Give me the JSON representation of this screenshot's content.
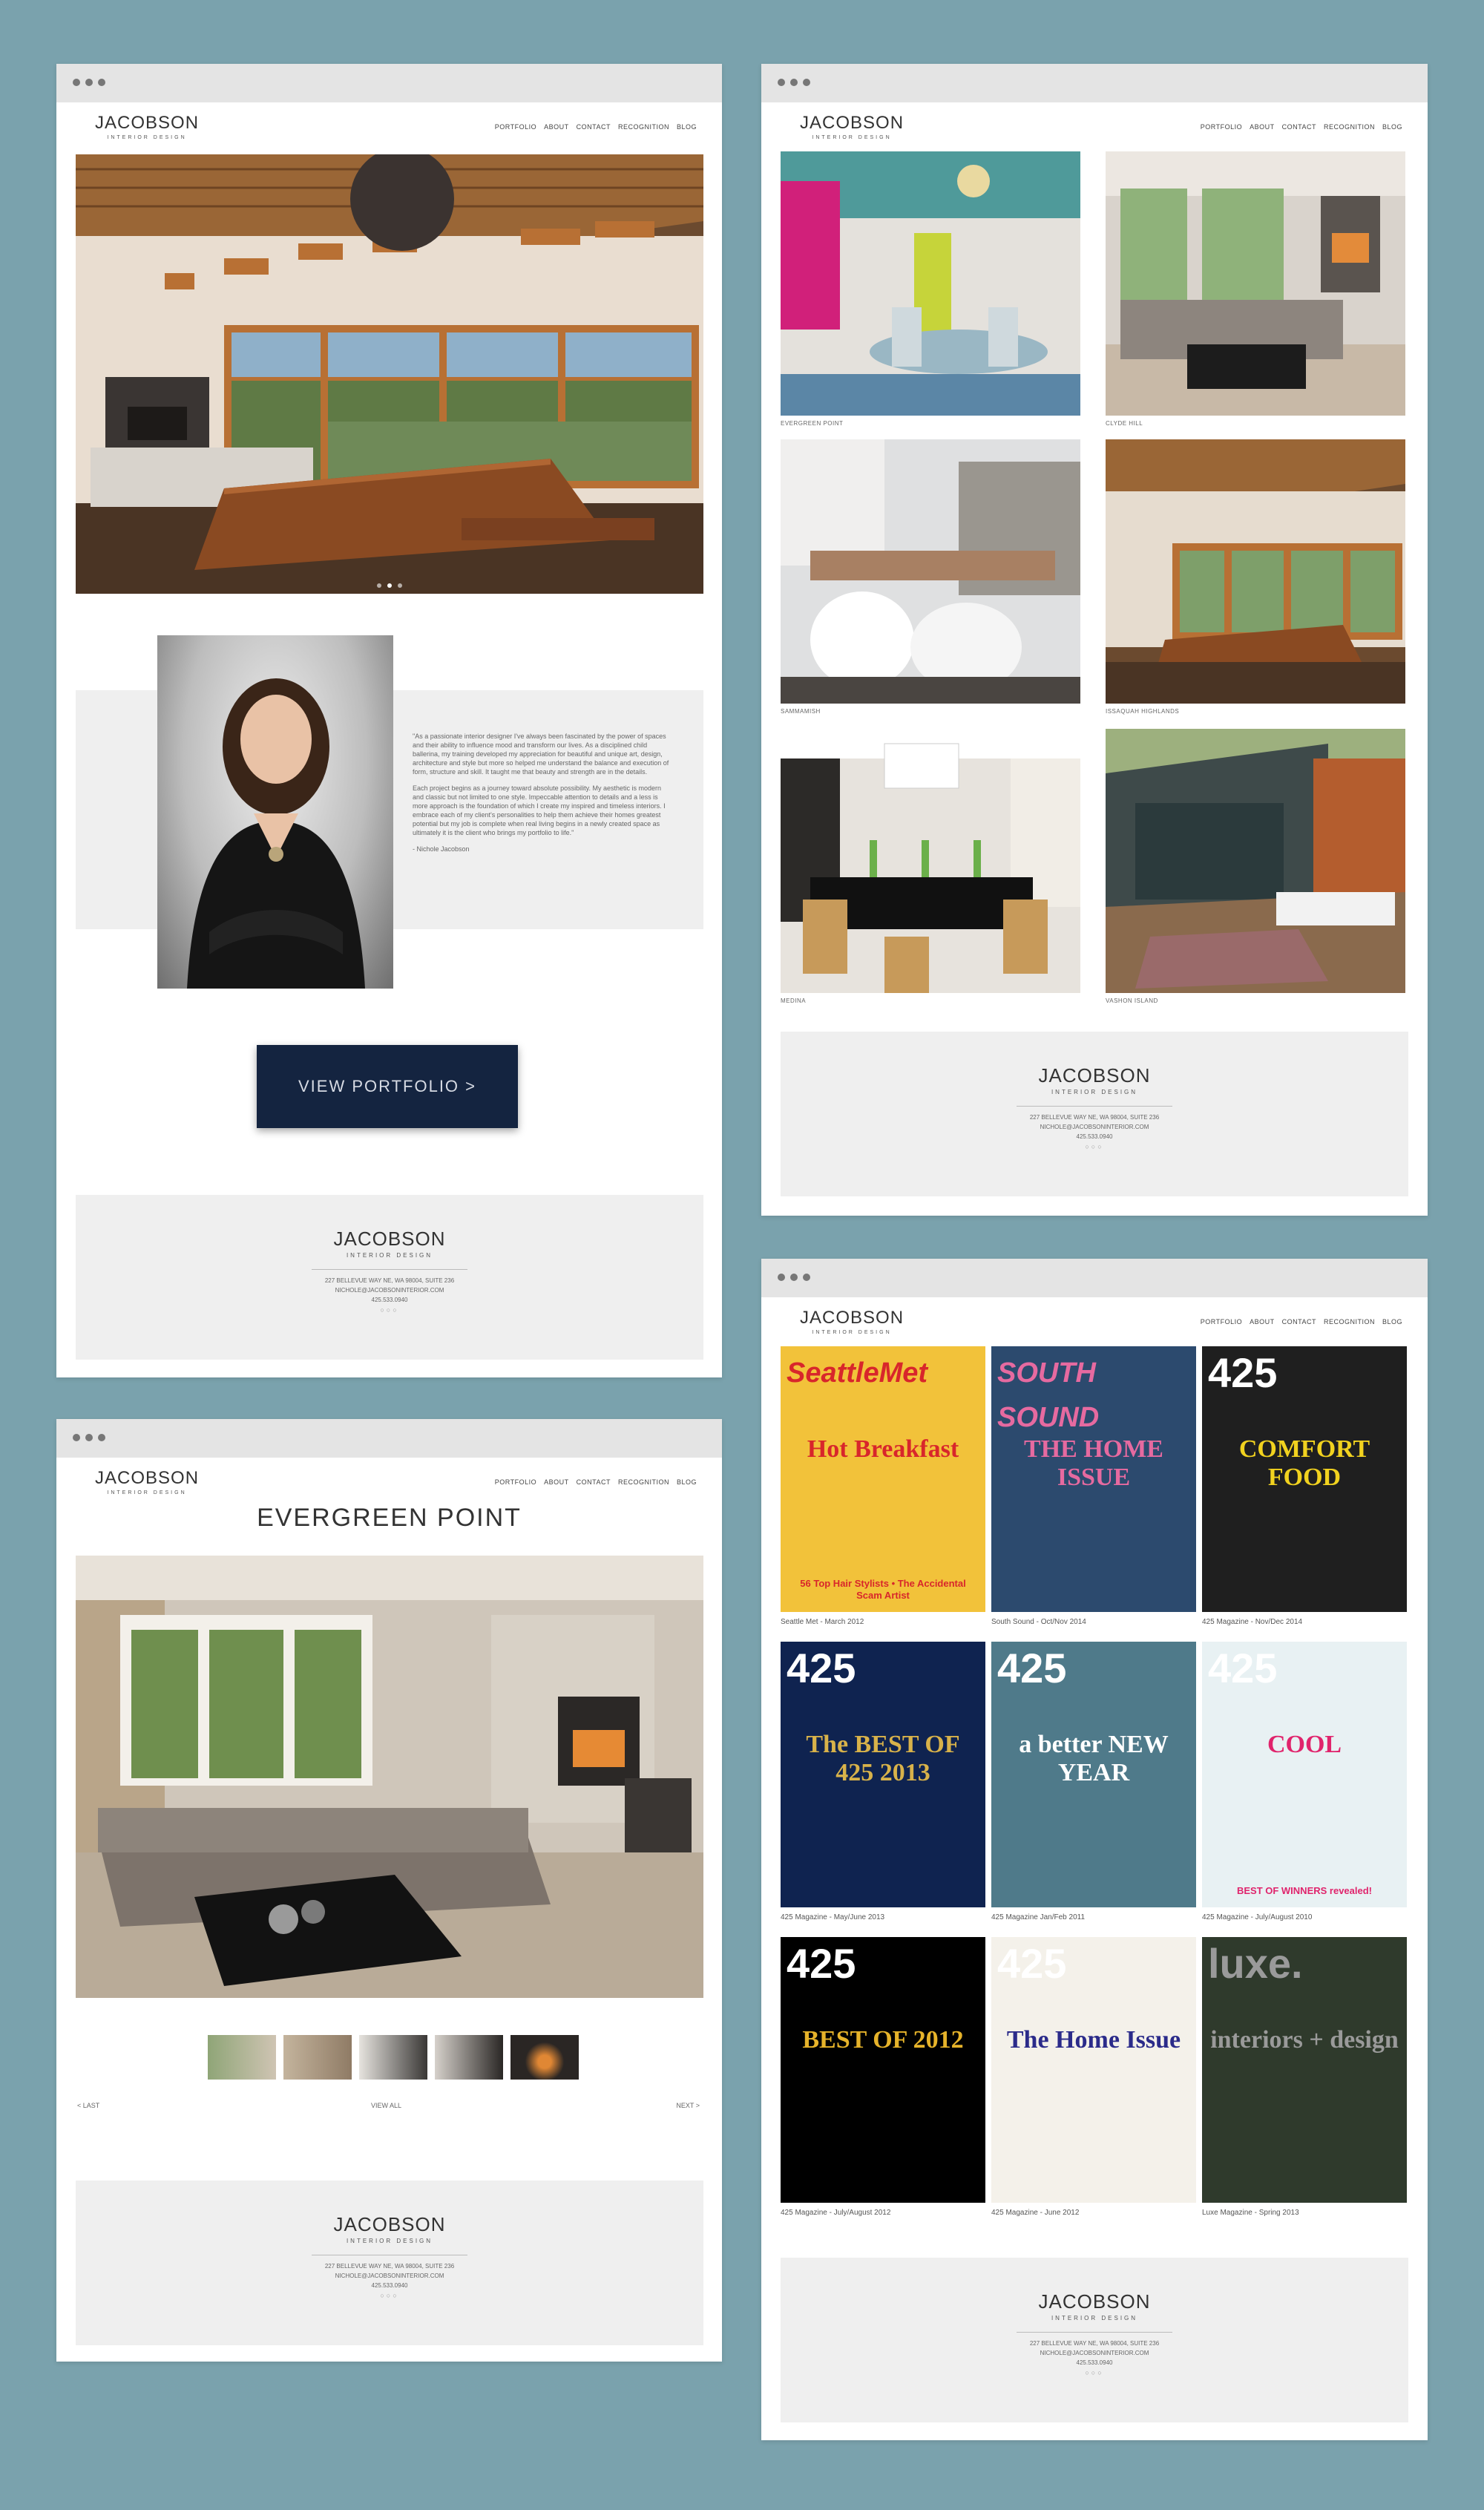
{
  "brand": {
    "name": "JACOBSON",
    "tagline": "INTERIOR DESIGN"
  },
  "nav": [
    "PORTFOLIO",
    "ABOUT",
    "CONTACT",
    "RECOGNITION",
    "BLOG"
  ],
  "footer": {
    "address": "227 BELLEVUE WAY NE, WA 98004, SUITE 236",
    "email": "NICHOLE@JACOBSONINTERIOR.COM",
    "phone": "425.533.0940",
    "social": "○○○"
  },
  "home": {
    "bio_p1": "\"As a passionate interior designer I've always been fascinated by the power of spaces and their ability to influence mood and transform our lives. As a disciplined child ballerina, my training developed my appreciation for beautiful and unique art, design, architecture and style but more so helped me understand the balance and execution of form, structure and skill. It taught me that beauty and strength are in the details.",
    "bio_p2": "Each project begins as a journey toward absolute possibility. My aesthetic is modern and classic but not limited to one style. Impeccable attention to details and a less is more approach is the foundation of which I create my inspired and timeless interiors. I embrace each of my client's personalities to help them achieve their homes greatest potential but my job is complete when real living begins in a newly created space as ultimately it is the client who brings my portfolio to life.\"",
    "bio_sign": "- Nichole Jacobson",
    "cta": "VIEW PORTFOLIO >"
  },
  "portfolio_grid": {
    "captions": [
      "EVERGREEN POINT",
      "CLYDE HILL",
      "SAMMAMISH",
      "ISSAQUAH HIGHLANDS",
      "MEDINA",
      "VASHON ISLAND"
    ]
  },
  "project": {
    "title": "EVERGREEN POINT",
    "prev": "< LAST",
    "view_all": "VIEW ALL",
    "next": "NEXT >"
  },
  "recognition": {
    "covers": [
      {
        "masthead": "SeattleMet",
        "headline": "Hot Breakfast",
        "sub": "56 Top Hair Stylists • The Accidental Scam Artist",
        "caption": "Seattle Met - March 2012",
        "bg": "#f2c23a",
        "fg": "#d8262b"
      },
      {
        "masthead": "SOUTH SOUND",
        "headline": "THE HOME ISSUE",
        "sub": "",
        "caption": "South Sound - Oct/Nov 2014",
        "bg": "#2c4a6e",
        "fg": "#e66aa0"
      },
      {
        "masthead": "425",
        "headline": "COMFORT FOOD",
        "sub": "",
        "caption": "425 Magazine - Nov/Dec 2014",
        "bg": "#1f1f1f",
        "fg": "#f1d21f"
      },
      {
        "masthead": "425",
        "headline": "The BEST OF 425 2013",
        "sub": "",
        "caption": "425 Magazine - May/June 2013",
        "bg": "#0f2350",
        "fg": "#d8b24a"
      },
      {
        "masthead": "425",
        "headline": "a better NEW YEAR",
        "sub": "",
        "caption": "425 Magazine Jan/Feb 2011",
        "bg": "#4f7a8a",
        "fg": "#ffffff"
      },
      {
        "masthead": "425",
        "headline": "COOL",
        "sub": "BEST OF WINNERS revealed!",
        "caption": "425 Magazine - July/August 2010",
        "bg": "#e8f1f3",
        "fg": "#e0246c"
      },
      {
        "masthead": "425",
        "headline": "BEST OF 2012",
        "sub": "",
        "caption": "425 Magazine - July/August 2012",
        "bg": "#000000",
        "fg": "#e6b32a"
      },
      {
        "masthead": "425",
        "headline": "The Home Issue",
        "sub": "",
        "caption": "425 Magazine - June 2012",
        "bg": "#f4f1ea",
        "fg": "#2b2b8a"
      },
      {
        "masthead": "luxe.",
        "headline": "interiors + design",
        "sub": "",
        "caption": "Luxe Magazine - Spring 2013",
        "bg": "#2f3a2c",
        "fg": "#9a9a9a"
      }
    ]
  }
}
